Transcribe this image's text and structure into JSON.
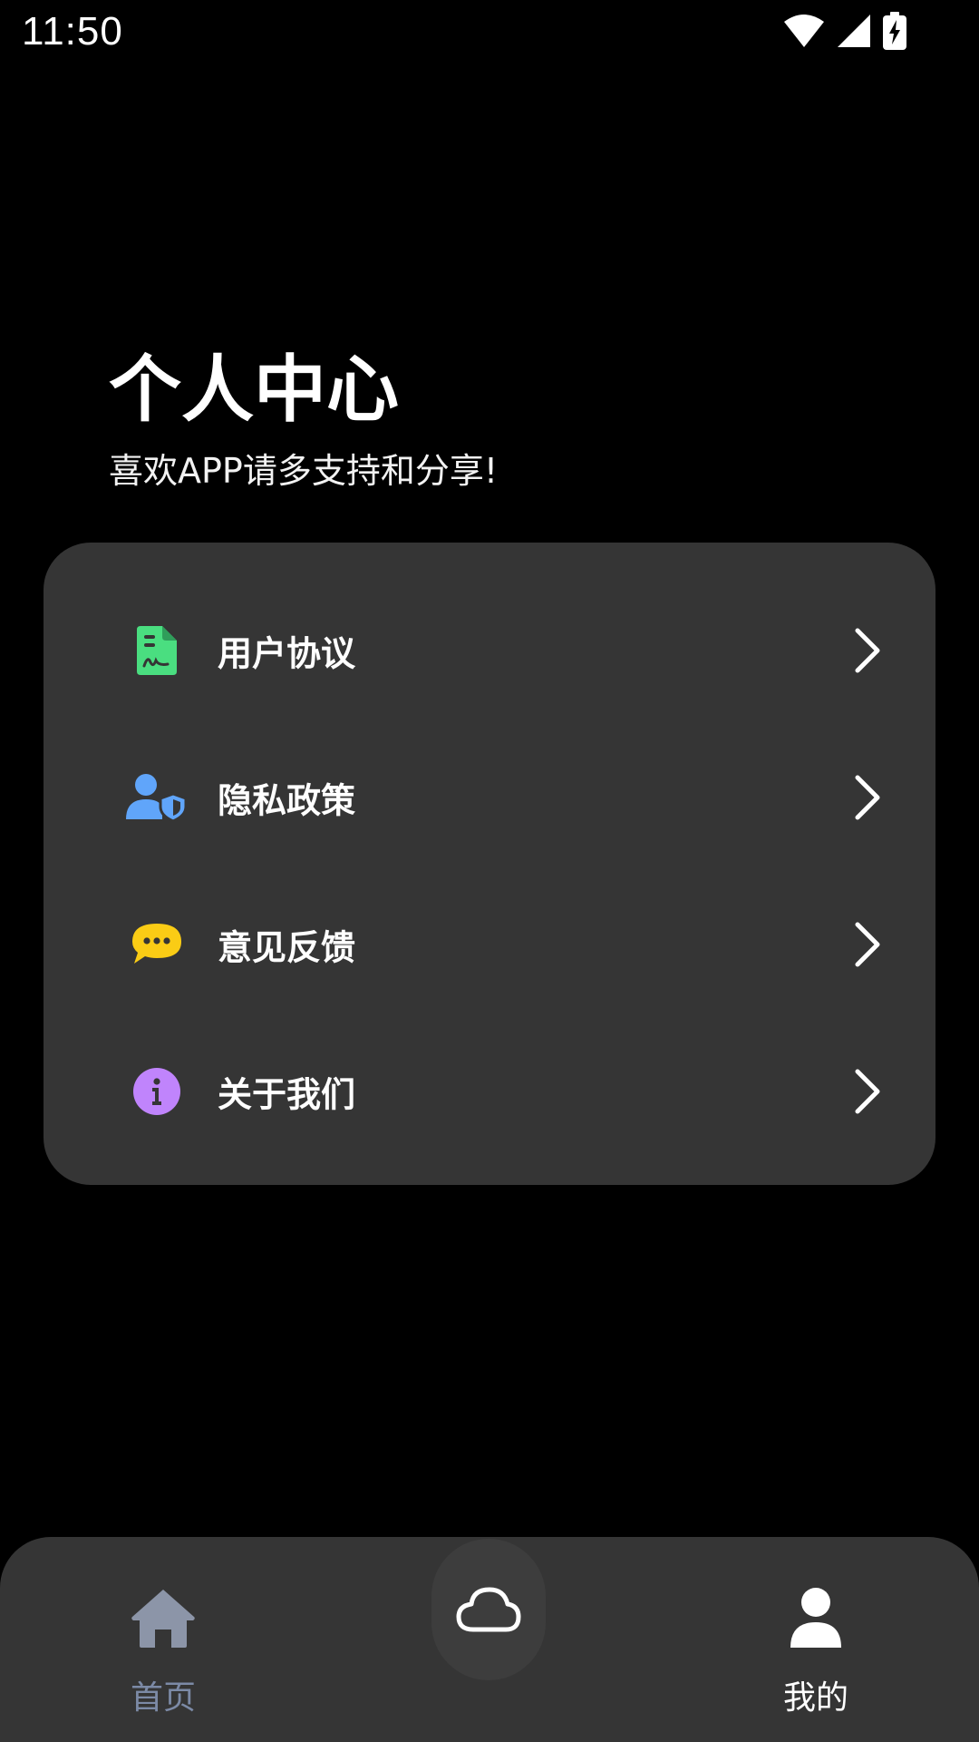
{
  "status_bar": {
    "time": "11:50",
    "icons": [
      "wifi-icon",
      "cellular-signal-icon",
      "battery-charging-icon"
    ]
  },
  "header": {
    "title": "个人中心",
    "subtitle": "喜欢APP请多支持和分享!"
  },
  "menu": {
    "items": [
      {
        "label": "用户协议",
        "icon": "document-icon",
        "icon_color": "#4ade80"
      },
      {
        "label": "隐私政策",
        "icon": "user-shield-icon",
        "icon_color": "#60a5fa"
      },
      {
        "label": "意见反馈",
        "icon": "chat-bubble-icon",
        "icon_color": "#facc15"
      },
      {
        "label": "关于我们",
        "icon": "info-icon",
        "icon_color": "#c084fc"
      }
    ]
  },
  "bottom_nav": {
    "items": [
      {
        "label": "首页",
        "icon": "home-icon",
        "active": false
      },
      {
        "label": "",
        "icon": "cloud-icon",
        "active": false
      },
      {
        "label": "我的",
        "icon": "user-icon",
        "active": true
      }
    ]
  },
  "colors": {
    "background": "#000000",
    "card": "#353535",
    "inactive_nav": "#7c8aa6",
    "active_nav": "#ffffff"
  }
}
